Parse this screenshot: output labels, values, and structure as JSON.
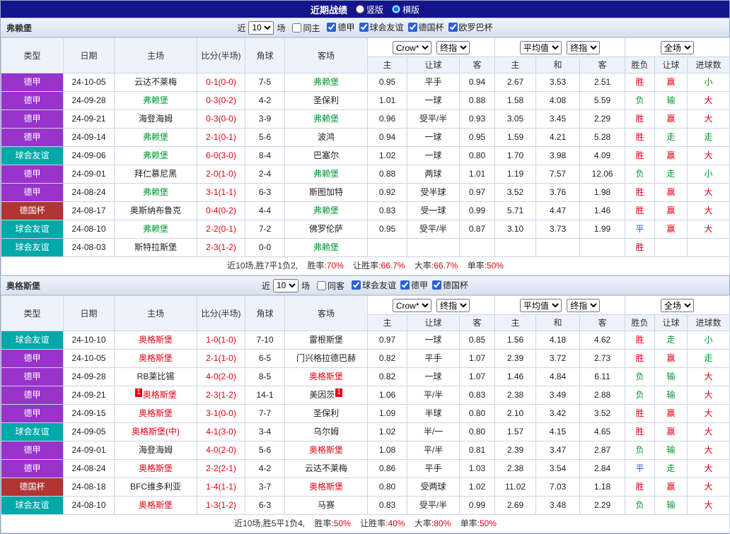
{
  "topbar": {
    "title": "近期战绩",
    "vertical": "竖版",
    "horizontal": "横版"
  },
  "headers": {
    "type": "类型",
    "date": "日期",
    "home": "主场",
    "score": "比分(半场)",
    "corner": "角球",
    "away": "客场",
    "asia": [
      "主",
      "让球",
      "客"
    ],
    "europe": [
      "主",
      "和",
      "客"
    ],
    "result": [
      "胜负",
      "让球",
      "进球数"
    ]
  },
  "colors": {
    "topbar": "#14148c",
    "red": "#e60012",
    "green": "#009933",
    "blue": "#2f55cc",
    "league_purple": "#9933cc",
    "league_teal": "#00a8a8",
    "league_darkred": "#b23434",
    "band_bg": "#dce4f2",
    "header_bg": "#eef2fa",
    "border": "#ccd5e5"
  },
  "sections": [
    {
      "team": "弗赖堡",
      "filter": {
        "near": "近",
        "count": "10",
        "unit": "场",
        "same": "同主",
        "leagues": [
          "德甲",
          "球会友谊",
          "德国杯",
          "欧罗巴杯"
        ]
      },
      "dropdowns": {
        "book": "Crow*",
        "book_time": "终指",
        "europe": "平均值",
        "europe_time": "终指",
        "scope": "全场"
      },
      "rows": [
        {
          "lg": "德甲",
          "lgc": "purple",
          "date": "24-10-05",
          "home": "云达不莱梅",
          "homec": "",
          "score": "0-1(0-0)",
          "corner": "7-5",
          "away": "弗赖堡",
          "awayc": "green",
          "ah": [
            "0.95",
            "平手",
            "0.94"
          ],
          "eu": [
            "2.67",
            "3.53",
            "2.51"
          ],
          "res": [
            "胜",
            "red"
          ],
          "let": [
            "赢",
            "red"
          ],
          "goal": [
            "小",
            "green"
          ]
        },
        {
          "lg": "德甲",
          "lgc": "purple",
          "date": "24-09-28",
          "home": "弗赖堡",
          "homec": "green",
          "score": "0-3(0-2)",
          "corner": "4-2",
          "away": "圣保利",
          "awayc": "",
          "ah": [
            "1.01",
            "一球",
            "0.88"
          ],
          "eu": [
            "1.58",
            "4.08",
            "5.59"
          ],
          "res": [
            "负",
            "green"
          ],
          "let": [
            "输",
            "green"
          ],
          "goal": [
            "大",
            "red"
          ]
        },
        {
          "lg": "德甲",
          "lgc": "purple",
          "date": "24-09-21",
          "home": "海登海姆",
          "homec": "",
          "score": "0-3(0-0)",
          "corner": "3-9",
          "away": "弗赖堡",
          "awayc": "green",
          "ah": [
            "0.96",
            "受平/半",
            "0.93"
          ],
          "eu": [
            "3.05",
            "3.45",
            "2.29"
          ],
          "res": [
            "胜",
            "red"
          ],
          "let": [
            "赢",
            "red"
          ],
          "goal": [
            "大",
            "red"
          ]
        },
        {
          "lg": "德甲",
          "lgc": "purple",
          "date": "24-09-14",
          "home": "弗赖堡",
          "homec": "green",
          "score": "2-1(0-1)",
          "corner": "5-6",
          "away": "波鸿",
          "awayc": "",
          "ah": [
            "0.94",
            "一球",
            "0.95"
          ],
          "eu": [
            "1.59",
            "4.21",
            "5.28"
          ],
          "res": [
            "胜",
            "red"
          ],
          "let": [
            "走",
            "green"
          ],
          "goal": [
            "走",
            "green"
          ]
        },
        {
          "lg": "球会友谊",
          "lgc": "teal",
          "date": "24-09-06",
          "home": "弗赖堡",
          "homec": "green",
          "score": "6-0(3-0)",
          "corner": "8-4",
          "away": "巴塞尔",
          "awayc": "",
          "ah": [
            "1.02",
            "一球",
            "0.80"
          ],
          "eu": [
            "1.70",
            "3.98",
            "4.09"
          ],
          "res": [
            "胜",
            "red"
          ],
          "let": [
            "赢",
            "red"
          ],
          "goal": [
            "大",
            "red"
          ]
        },
        {
          "lg": "德甲",
          "lgc": "purple",
          "date": "24-09-01",
          "home": "拜仁慕尼黑",
          "homec": "",
          "score": "2-0(1-0)",
          "corner": "2-4",
          "away": "弗赖堡",
          "awayc": "green",
          "ah": [
            "0.88",
            "两球",
            "1.01"
          ],
          "eu": [
            "1.19",
            "7.57",
            "12.06"
          ],
          "res": [
            "负",
            "green"
          ],
          "let": [
            "走",
            "green"
          ],
          "goal": [
            "小",
            "green"
          ]
        },
        {
          "lg": "德甲",
          "lgc": "purple",
          "date": "24-08-24",
          "home": "弗赖堡",
          "homec": "green",
          "score": "3-1(1-1)",
          "corner": "6-3",
          "away": "斯图加特",
          "awayc": "",
          "ah": [
            "0.92",
            "受半球",
            "0.97"
          ],
          "eu": [
            "3.52",
            "3.76",
            "1.98"
          ],
          "res": [
            "胜",
            "red"
          ],
          "let": [
            "赢",
            "red"
          ],
          "goal": [
            "大",
            "red"
          ]
        },
        {
          "lg": "德国杯",
          "lgc": "darkred",
          "date": "24-08-17",
          "home": "奥斯纳布鲁克",
          "homec": "",
          "score": "0-4(0-2)",
          "corner": "4-4",
          "away": "弗赖堡",
          "awayc": "green",
          "ah": [
            "0.83",
            "受一球",
            "0.99"
          ],
          "eu": [
            "5.71",
            "4.47",
            "1.46"
          ],
          "res": [
            "胜",
            "red"
          ],
          "let": [
            "赢",
            "red"
          ],
          "goal": [
            "大",
            "red"
          ]
        },
        {
          "lg": "球会友谊",
          "lgc": "teal",
          "date": "24-08-10",
          "home": "弗赖堡",
          "homec": "green",
          "score": "2-2(0-1)",
          "corner": "7-2",
          "away": "佛罗伦萨",
          "awayc": "",
          "ah": [
            "0.95",
            "受平/半",
            "0.87"
          ],
          "eu": [
            "3.10",
            "3.73",
            "1.99"
          ],
          "res": [
            "平",
            "blue"
          ],
          "let": [
            "赢",
            "red"
          ],
          "goal": [
            "大",
            "red"
          ]
        },
        {
          "lg": "球会友谊",
          "lgc": "teal",
          "date": "24-08-03",
          "home": "斯特拉斯堡",
          "homec": "",
          "score": "2-3(1-2)",
          "corner": "0-0",
          "away": "弗赖堡",
          "awayc": "green",
          "ah": [
            "",
            "",
            ""
          ],
          "eu": [
            "",
            "",
            ""
          ],
          "res": [
            "胜",
            "red"
          ],
          "let": [
            "",
            ""
          ],
          "goal": [
            "",
            ""
          ]
        }
      ],
      "summary": {
        "intro": "近10场,胜7平1负2,",
        "stats": [
          {
            "label": "胜率:",
            "value": "70%"
          },
          {
            "label": "让胜率:",
            "value": "66.7%"
          },
          {
            "label": "大率:",
            "value": "66.7%"
          },
          {
            "label": "单率:",
            "value": "50%"
          }
        ]
      }
    },
    {
      "team": "奥格斯堡",
      "filter": {
        "near": "近",
        "count": "10",
        "unit": "场",
        "same": "同客",
        "leagues": [
          "球会友谊",
          "德甲",
          "德国杯"
        ]
      },
      "dropdowns": {
        "book": "Crow*",
        "book_time": "终指",
        "europe": "平均值",
        "europe_time": "终指",
        "scope": "全场"
      },
      "rows": [
        {
          "lg": "球会友谊",
          "lgc": "teal",
          "date": "24-10-10",
          "home": "奥格斯堡",
          "homec": "red",
          "score": "1-0(1-0)",
          "corner": "7-10",
          "away": "雷根斯堡",
          "awayc": "",
          "ah": [
            "0.97",
            "一球",
            "0.85"
          ],
          "eu": [
            "1.56",
            "4.18",
            "4.62"
          ],
          "res": [
            "胜",
            "red"
          ],
          "let": [
            "走",
            "green"
          ],
          "goal": [
            "小",
            "green"
          ]
        },
        {
          "lg": "德甲",
          "lgc": "purple",
          "date": "24-10-05",
          "home": "奥格斯堡",
          "homec": "red",
          "score": "2-1(1-0)",
          "corner": "6-5",
          "away": "门兴格拉德巴赫",
          "awayc": "",
          "ah": [
            "0.82",
            "平手",
            "1.07"
          ],
          "eu": [
            "2.39",
            "3.72",
            "2.73"
          ],
          "res": [
            "胜",
            "red"
          ],
          "let": [
            "赢",
            "red"
          ],
          "goal": [
            "走",
            "green"
          ]
        },
        {
          "lg": "德甲",
          "lgc": "purple",
          "date": "24-09-28",
          "home": "RB莱比锡",
          "homec": "",
          "score": "4-0(2-0)",
          "corner": "8-5",
          "away": "奥格斯堡",
          "awayc": "red",
          "ah": [
            "0.82",
            "一球",
            "1.07"
          ],
          "eu": [
            "1.46",
            "4.84",
            "6.11"
          ],
          "res": [
            "负",
            "green"
          ],
          "let": [
            "输",
            "green"
          ],
          "goal": [
            "大",
            "red"
          ]
        },
        {
          "lg": "德甲",
          "lgc": "purple",
          "date": "24-09-21",
          "home": "奥格斯堡",
          "homec": "red",
          "hb": "1",
          "score": "2-3(1-2)",
          "corner": "14-1",
          "away": "美因茨",
          "awayc": "",
          "ab": "1",
          "ah": [
            "1.06",
            "平/半",
            "0.83"
          ],
          "eu": [
            "2.38",
            "3.49",
            "2.88"
          ],
          "res": [
            "负",
            "green"
          ],
          "let": [
            "输",
            "green"
          ],
          "goal": [
            "大",
            "red"
          ]
        },
        {
          "lg": "德甲",
          "lgc": "purple",
          "date": "24-09-15",
          "home": "奥格斯堡",
          "homec": "red",
          "score": "3-1(0-0)",
          "corner": "7-7",
          "away": "圣保利",
          "awayc": "",
          "ah": [
            "1.09",
            "半球",
            "0.80"
          ],
          "eu": [
            "2.10",
            "3.42",
            "3.52"
          ],
          "res": [
            "胜",
            "red"
          ],
          "let": [
            "赢",
            "red"
          ],
          "goal": [
            "大",
            "red"
          ]
        },
        {
          "lg": "球会友谊",
          "lgc": "teal",
          "date": "24-09-05",
          "home": "奥格斯堡(中)",
          "homec": "red",
          "score": "4-1(3-0)",
          "corner": "3-4",
          "away": "乌尔姆",
          "awayc": "",
          "ah": [
            "1.02",
            "半/一",
            "0.80"
          ],
          "eu": [
            "1.57",
            "4.15",
            "4.65"
          ],
          "res": [
            "胜",
            "red"
          ],
          "let": [
            "赢",
            "red"
          ],
          "goal": [
            "大",
            "red"
          ]
        },
        {
          "lg": "德甲",
          "lgc": "purple",
          "date": "24-09-01",
          "home": "海登海姆",
          "homec": "",
          "score": "4-0(2-0)",
          "corner": "5-6",
          "away": "奥格斯堡",
          "awayc": "red",
          "ah": [
            "1.08",
            "平/半",
            "0.81"
          ],
          "eu": [
            "2.39",
            "3.47",
            "2.87"
          ],
          "res": [
            "负",
            "green"
          ],
          "let": [
            "输",
            "green"
          ],
          "goal": [
            "大",
            "red"
          ]
        },
        {
          "lg": "德甲",
          "lgc": "purple",
          "date": "24-08-24",
          "home": "奥格斯堡",
          "homec": "red",
          "score": "2-2(2-1)",
          "corner": "4-2",
          "away": "云达不莱梅",
          "awayc": "",
          "ah": [
            "0.86",
            "平手",
            "1.03"
          ],
          "eu": [
            "2.38",
            "3.54",
            "2.84"
          ],
          "res": [
            "平",
            "blue"
          ],
          "let": [
            "走",
            "green"
          ],
          "goal": [
            "大",
            "red"
          ]
        },
        {
          "lg": "德国杯",
          "lgc": "darkred",
          "date": "24-08-18",
          "home": "BFC维多利亚",
          "homec": "",
          "score": "1-4(1-1)",
          "corner": "3-7",
          "away": "奥格斯堡",
          "awayc": "red",
          "ah": [
            "0.80",
            "受两球",
            "1.02"
          ],
          "eu": [
            "11.02",
            "7.03",
            "1.18"
          ],
          "res": [
            "胜",
            "red"
          ],
          "let": [
            "赢",
            "red"
          ],
          "goal": [
            "大",
            "red"
          ]
        },
        {
          "lg": "球会友谊",
          "lgc": "teal",
          "date": "24-08-10",
          "home": "奥格斯堡",
          "homec": "red",
          "score": "1-3(1-2)",
          "corner": "6-3",
          "away": "马赛",
          "awayc": "",
          "ah": [
            "0.83",
            "受平/半",
            "0.99"
          ],
          "eu": [
            "2.69",
            "3.48",
            "2.29"
          ],
          "res": [
            "负",
            "green"
          ],
          "let": [
            "输",
            "green"
          ],
          "goal": [
            "大",
            "red"
          ]
        }
      ],
      "summary": {
        "intro": "近10场,胜5平1负4,",
        "stats": [
          {
            "label": "胜率:",
            "value": "50%"
          },
          {
            "label": "让胜率:",
            "value": "40%"
          },
          {
            "label": "大率:",
            "value": "80%"
          },
          {
            "label": "单率:",
            "value": "50%"
          }
        ]
      }
    }
  ]
}
